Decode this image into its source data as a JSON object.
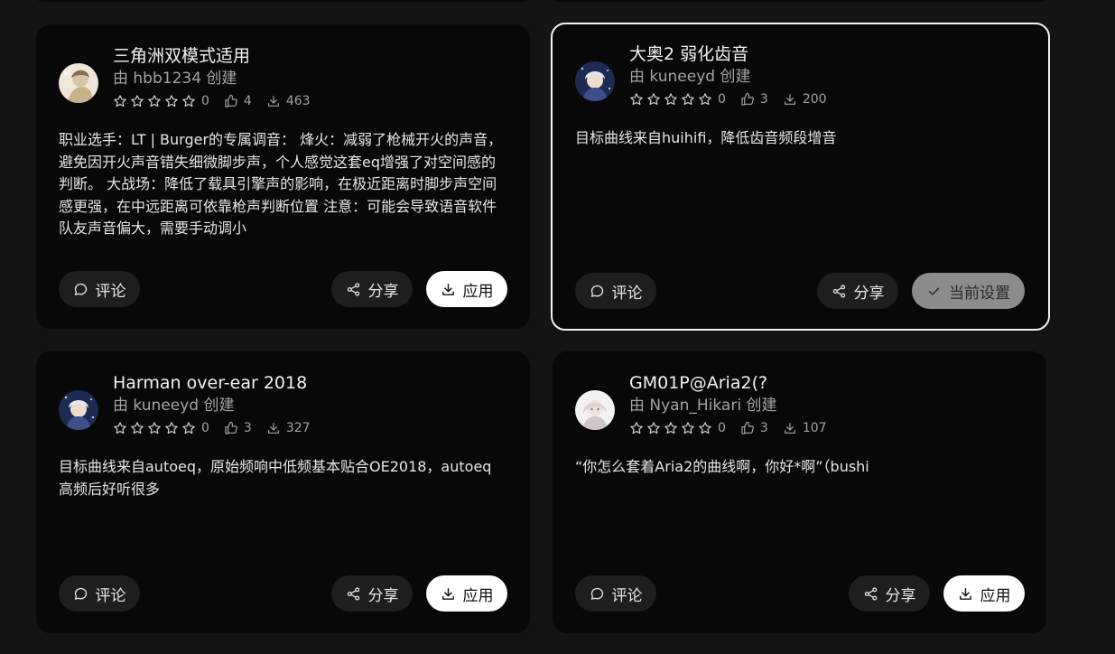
{
  "buttons": {
    "comment": "评论",
    "share": "分享",
    "apply": "应用",
    "current": "当前设置"
  },
  "cards": [
    {
      "title": "三角洲双模式适用",
      "author": "由 hbb1234 创建",
      "rating": "0",
      "likes": "4",
      "downloads": "463",
      "description": "职业选手：LT | Burger的专属调音： 烽火：减弱了枪械开火的声音，避免因开火声音错失细微脚步声，个人感觉这套eq增强了对空间感的判断。 大战场：降低了载具引擎声的影响，在极近距离时脚步声空间感更强，在中远距离可依靠枪声判断位置 注意：可能会导致语音软件队友声音偏大，需要手动调小",
      "selected": false
    },
    {
      "title": "大奥2 弱化齿音",
      "author": "由 kuneeyd 创建",
      "rating": "0",
      "likes": "3",
      "downloads": "200",
      "description": "目标曲线来自huihifi，降低齿音频段增音",
      "selected": true
    },
    {
      "title": "Harman over-ear 2018",
      "author": "由 kuneeyd 创建",
      "rating": "0",
      "likes": "3",
      "downloads": "327",
      "description": "目标曲线来自autoeq，原始频响中低频基本贴合OE2018，autoeq高频后好听很多",
      "selected": false
    },
    {
      "title": "GM01P@Aria2(?",
      "author": "由 Nyan_Hikari 创建",
      "rating": "0",
      "likes": "3",
      "downloads": "107",
      "description": "“你怎么套着Aria2的曲线啊，你好*啊”（bushi",
      "selected": false
    }
  ],
  "icons": {
    "comment": "comment-icon",
    "share": "share-icon",
    "download": "download-icon",
    "check": "check-icon",
    "star": "star-outline-icon",
    "like": "thumbs-up-icon"
  },
  "colors": {
    "background": "#141414",
    "card": "#080808",
    "selected_border": "#f2f2f2",
    "button_dark": "#1e1e1e",
    "button_light": "#ffffff",
    "button_current": "#8c8c8c"
  }
}
